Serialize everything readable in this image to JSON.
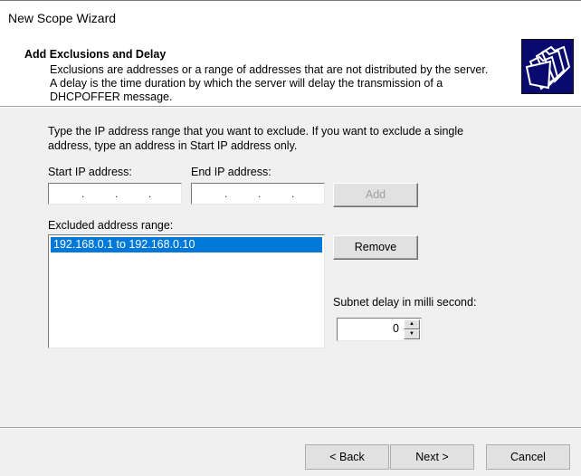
{
  "window": {
    "title": "New Scope Wizard"
  },
  "header": {
    "title": "Add Exclusions and Delay",
    "description_lines": [
      "Exclusions are addresses or a range of addresses that are not distributed by the server.",
      "A delay is the time duration by which the server will delay the transmission of a",
      "DHCPOFFER message."
    ],
    "icon": "folders-icon"
  },
  "body": {
    "instructions_lines": [
      "Type the IP address range that you want to exclude. If you want to exclude a single",
      "address, type an address in Start IP address only."
    ],
    "start_ip": {
      "label": "Start IP address:",
      "value": ""
    },
    "end_ip": {
      "label": "End IP address:",
      "value": ""
    },
    "add_label": "Add",
    "excluded_label": "Excluded address range:",
    "excluded_items": [
      "192.168.0.1 to 192.168.0.10"
    ],
    "remove_label": "Remove",
    "delay_label": "Subnet delay in milli second:",
    "delay_value": "0"
  },
  "footer": {
    "back_label": "< Back",
    "next_label": "Next >",
    "cancel_label": "Cancel"
  },
  "colors": {
    "selection": "#0078d7",
    "icon_bg": "#0a0a6e"
  }
}
